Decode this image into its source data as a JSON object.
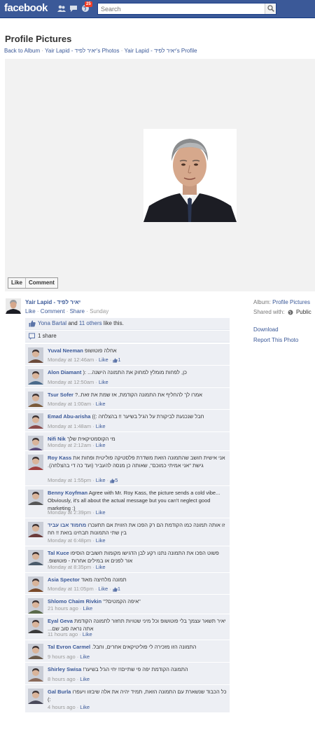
{
  "header": {
    "logo": "facebook",
    "notification_count": "25",
    "search_placeholder": "Search"
  },
  "page": {
    "title": "Profile Pictures",
    "breadcrumb": [
      "Back to Album",
      "Yair Lapid - יאיר לפיד's Photos",
      "Yair Lapid - יאיר לפיד's Profile"
    ]
  },
  "photo_actions": {
    "like": "Like",
    "comment": "Comment"
  },
  "owner": {
    "name": "Yair Lapid - יאיר לפיד",
    "actions": [
      "Like",
      "Comment",
      "Share"
    ],
    "time": "Sunday"
  },
  "sidebar": {
    "album_label": "Album:",
    "album_value": "Profile Pictures",
    "shared_label": "Shared with:",
    "shared_value": "Public",
    "download": "Download",
    "report": "Report This Photo"
  },
  "likes": {
    "name": "Yona Bartal",
    "and": "and",
    "others": "11 others",
    "suffix": "like this."
  },
  "shares": "1 share",
  "comments": [
    {
      "author": "Yuval Neeman",
      "text": "אחלה פוטושופ",
      "time": "Monday at 12:46am",
      "like": "Like",
      "likes": "1",
      "rtl": true,
      "color": "#6b4a3a"
    },
    {
      "author": "Alon Diamant",
      "text": "כן, לפחות מומלץ למחוק את התמונה הישנה... :(",
      "time": "Monday at 12:50am",
      "like": "Like",
      "likes": "",
      "rtl": true,
      "color": "#4a6a8a"
    },
    {
      "author": "Tsur Sofer",
      "text": "אמרו לך להחליף את התמונה הקודמת, אז שמת את זאת..?",
      "time": "Monday at 1:00am",
      "like": "Like",
      "likes": "",
      "rtl": true,
      "color": "#7a5a3a"
    },
    {
      "author": "Emad Abu-arisha",
      "text": "חבל שנכנעת לביקורת על הג'ל בשיער !! בהצלחה :))",
      "time": "Monday at 1:48am",
      "like": "Like",
      "likes": "",
      "rtl": true,
      "color": "#8a4a4a"
    },
    {
      "author": "Nifi Nik",
      "text": "מי הקוסמטיקאית שלך",
      "time": "Monday at 2:12am",
      "like": "Like",
      "likes": "",
      "rtl": true,
      "color": "#5a4a7a"
    },
    {
      "author": "Roy Kass",
      "text": "אני אישית חושב שהתמונה הזאת משדרת פלסטיקה פוליטית ופחות את גישת \"אני אמיתי כמוכם\", שאותה כן מנסה להעביר (ועד כה די בהצלחה).",
      "time": "Monday at 1:55pm",
      "like": "Like",
      "likes": "5",
      "rtl": true,
      "color": "#a04040"
    },
    {
      "author": "Benny Koyfman",
      "text": "Agree with Mr. Roy Kass, the picture sends a cold vibe... Obviously, it's all about the actual message but you can't neglect good marketing :)",
      "time": "Monday at 2:39pm",
      "like": "Like",
      "likes": "",
      "rtl": false,
      "color": "#555555"
    },
    {
      "author": "מחמוד אבו עביד",
      "text": "זו אותה תמונה כמו הקודמת הם רק הפכו את הזווית אם תתעכרו בין שתי התמונות תבחינו בזאת !! חח",
      "time": "Monday at 6:48pm",
      "like": "Like",
      "likes": "",
      "rtl": true,
      "color": "#6a3a3a"
    },
    {
      "author": "Tal Kuce",
      "text": "פשוט הפכו את התמונה נתנו רקע לבן הדגישו מקומות חשובים הוסיפו אור לפנים או במילים אחרות - פוטושופ.",
      "time": "Monday at 8:35pm",
      "like": "Like",
      "likes": "",
      "rtl": true,
      "color": "#4a5a6a"
    },
    {
      "author": "Asia Spector",
      "text": "תמונה מלחיצה מאוד",
      "time": "Monday at 11:05pm",
      "like": "Like",
      "likes": "1",
      "rtl": true,
      "color": "#7a4a2a"
    },
    {
      "author": "Shlomo Chaim Rivkin",
      "text": "\"איפה הקמטים?\"",
      "time": "21 hours ago",
      "like": "Like",
      "likes": "",
      "rtl": true,
      "color": "#5a6a4a"
    },
    {
      "author": "Eyal Geva",
      "text": "יאיר תשאר עצמך בלי פוטושופ וכל מיני שטויות תחזור לתמונה הקודמת אתה נראה סוב שם...",
      "time": "11 hours ago",
      "like": "Like",
      "likes": "",
      "rtl": true,
      "color": "#3a3a3a"
    },
    {
      "author": "Tal Evron Carmel",
      "text": "התמונה הזו מזכירה לי פוליטיקאים אחרים, וחבל.",
      "time": "9 hours ago",
      "like": "Like",
      "likes": "",
      "rtl": true,
      "color": "#6a5a4a"
    },
    {
      "author": "Shirley Swisa",
      "text": "התמונה הקודמת יפה פי שתיים!! יחי הג'ל בשיער!",
      "time": "8 hours ago",
      "like": "Like",
      "likes": "",
      "rtl": true,
      "color": "#8a6a5a"
    },
    {
      "author": "Gal Burla",
      "text": "כל הכבוד שנשארת עם התמונה הזאת, תמיד יהיה את אלה שיבזוו ויעפרו :)",
      "time": "4 hours ago",
      "like": "Like",
      "likes": "",
      "rtl": true,
      "color": "#4a4a5a"
    }
  ]
}
